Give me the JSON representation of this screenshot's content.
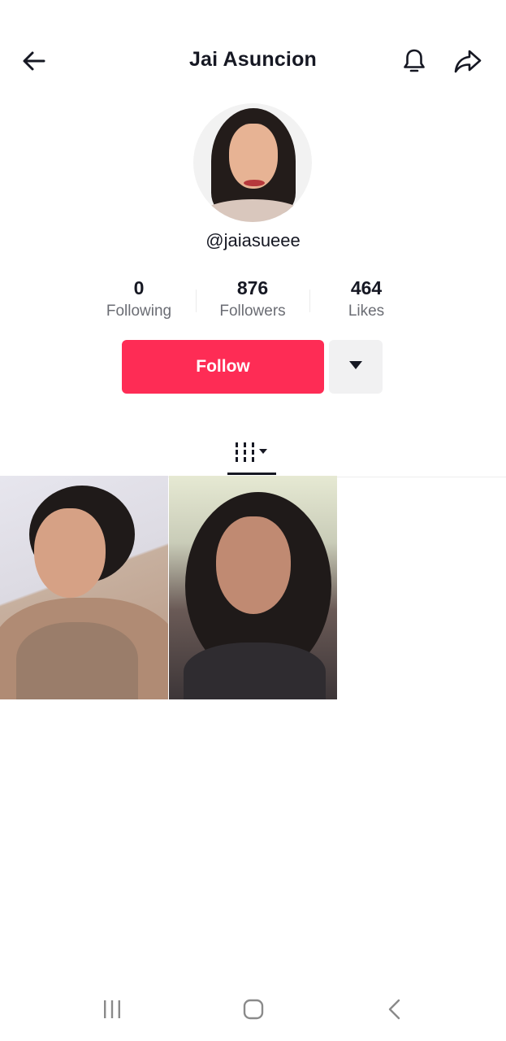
{
  "header": {
    "title": "Jai Asuncion",
    "back_icon": "arrow-left-icon",
    "bell_icon": "bell-icon",
    "share_icon": "share-arrow-icon"
  },
  "profile": {
    "username": "@jaiasueee",
    "avatar": "profile-avatar"
  },
  "stats": [
    {
      "value": "0",
      "label": "Following"
    },
    {
      "value": "876",
      "label": "Followers"
    },
    {
      "value": "464",
      "label": "Likes"
    }
  ],
  "actions": {
    "follow_label": "Follow",
    "more_icon": "caret-down-icon"
  },
  "tabs": {
    "videos_icon": "video-grid-icon"
  },
  "videos": [
    {
      "id": "thumb-1"
    },
    {
      "id": "thumb-2"
    }
  ],
  "system_nav": {
    "recents_icon": "recents-icon",
    "home_icon": "home-icon",
    "back_icon": "back-chevron-icon"
  },
  "colors": {
    "accent": "#fe2c55",
    "text_primary": "#161823",
    "text_secondary": "#6b6d74",
    "secondary_button": "#f1f1f2"
  }
}
